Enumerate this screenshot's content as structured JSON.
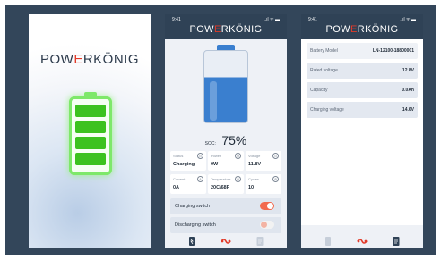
{
  "splash": {
    "logo_pre": "PO",
    "logo_w": "W",
    "logo_e": "E",
    "logo_post": "RKÖNIG",
    "battery_level": 1.0
  },
  "phone2": {
    "status_bar": {
      "time": "9:41",
      "sys": "..ıl ᯤ ▬"
    },
    "logo_pre": "POW",
    "logo_e": "E",
    "logo_post": "RKÖNIG",
    "battery_level": 0.75,
    "soc_label": "SOC:",
    "soc_value": "75%",
    "cards": [
      {
        "title": "Status",
        "value": "Charging",
        "icon": "status-icon"
      },
      {
        "title": "Power",
        "value": "0W",
        "icon": "power-icon"
      },
      {
        "title": "Voltage",
        "value": "11.8V",
        "icon": "voltage-icon"
      },
      {
        "title": "Current",
        "value": "0A",
        "icon": "current-icon"
      },
      {
        "title": "Temperature",
        "value": "20C/68F",
        "icon": "temperature-icon"
      },
      {
        "title": "Cycles",
        "value": "10",
        "icon": "cycles-icon"
      }
    ],
    "charging_switch": {
      "label": "Charging switch",
      "on": true
    },
    "discharging_switch": {
      "label": "Discharging switch",
      "on": false
    },
    "tabs": [
      "battery-tab-icon",
      "connection-tab-icon",
      "document-tab-icon"
    ]
  },
  "phone3": {
    "status_bar": {
      "time": "9:41",
      "sys": "..ıl ᯤ ▬"
    },
    "logo_pre": "POW",
    "logo_e": "E",
    "logo_post": "RKÖNIG",
    "rows": [
      {
        "key": "Battery Model",
        "value": "LN-12100-18800001"
      },
      {
        "key": "Rated voltage",
        "value": "12.8V"
      },
      {
        "key": "Capacity",
        "value": "0.0Ah"
      },
      {
        "key": "Charging voltage",
        "value": "14.6V"
      }
    ],
    "tabs": [
      "battery-tab-icon",
      "connection-tab-icon",
      "document-tab-icon"
    ]
  },
  "colors": {
    "accent": "#e23b2a",
    "header": "#2f4256",
    "battery_blue": "#3a7fcf",
    "battery_green": "#3cc21f",
    "toggle_on": "#f26a4f"
  }
}
